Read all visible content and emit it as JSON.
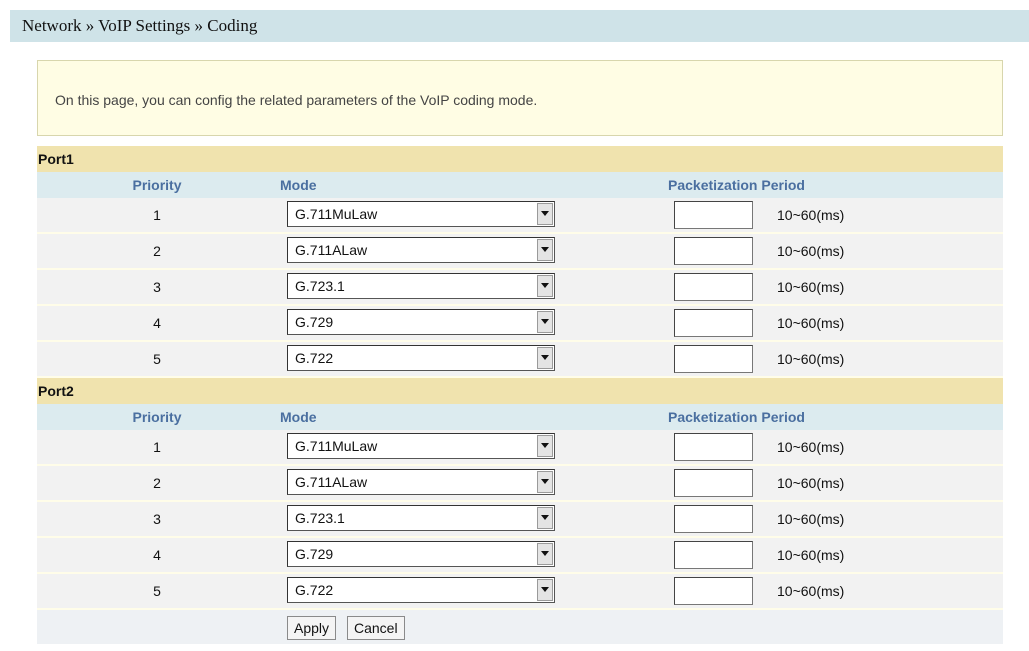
{
  "breadcrumb": "Network » VoIP Settings » Coding",
  "info_text": "On this page, you can config the related parameters of the VoIP coding mode.",
  "columns": {
    "priority": "Priority",
    "mode": "Mode",
    "packetization": "Packetization Period"
  },
  "range_label": "10~60(ms)",
  "ports": [
    {
      "name": "Port1",
      "rows": [
        {
          "priority": "1",
          "mode": "G.711MuLaw",
          "period": ""
        },
        {
          "priority": "2",
          "mode": "G.711ALaw",
          "period": ""
        },
        {
          "priority": "3",
          "mode": "G.723.1",
          "period": ""
        },
        {
          "priority": "4",
          "mode": "G.729",
          "period": ""
        },
        {
          "priority": "5",
          "mode": "G.722",
          "period": ""
        }
      ]
    },
    {
      "name": "Port2",
      "rows": [
        {
          "priority": "1",
          "mode": "G.711MuLaw",
          "period": ""
        },
        {
          "priority": "2",
          "mode": "G.711ALaw",
          "period": ""
        },
        {
          "priority": "3",
          "mode": "G.723.1",
          "period": ""
        },
        {
          "priority": "4",
          "mode": "G.729",
          "period": ""
        },
        {
          "priority": "5",
          "mode": "G.722",
          "period": ""
        }
      ]
    }
  ],
  "buttons": {
    "apply": "Apply",
    "cancel": "Cancel"
  },
  "icons": {
    "dropdown": "chevron-down-icon"
  },
  "colors": {
    "breadcrumb_bg": "#cfe3e8",
    "info_bg": "#fffde4",
    "port_header_bg": "#f0e3ae",
    "column_header_bg": "#dcebef",
    "column_header_text": "#4a6fa0",
    "row_bg": "#f2f2f2"
  }
}
